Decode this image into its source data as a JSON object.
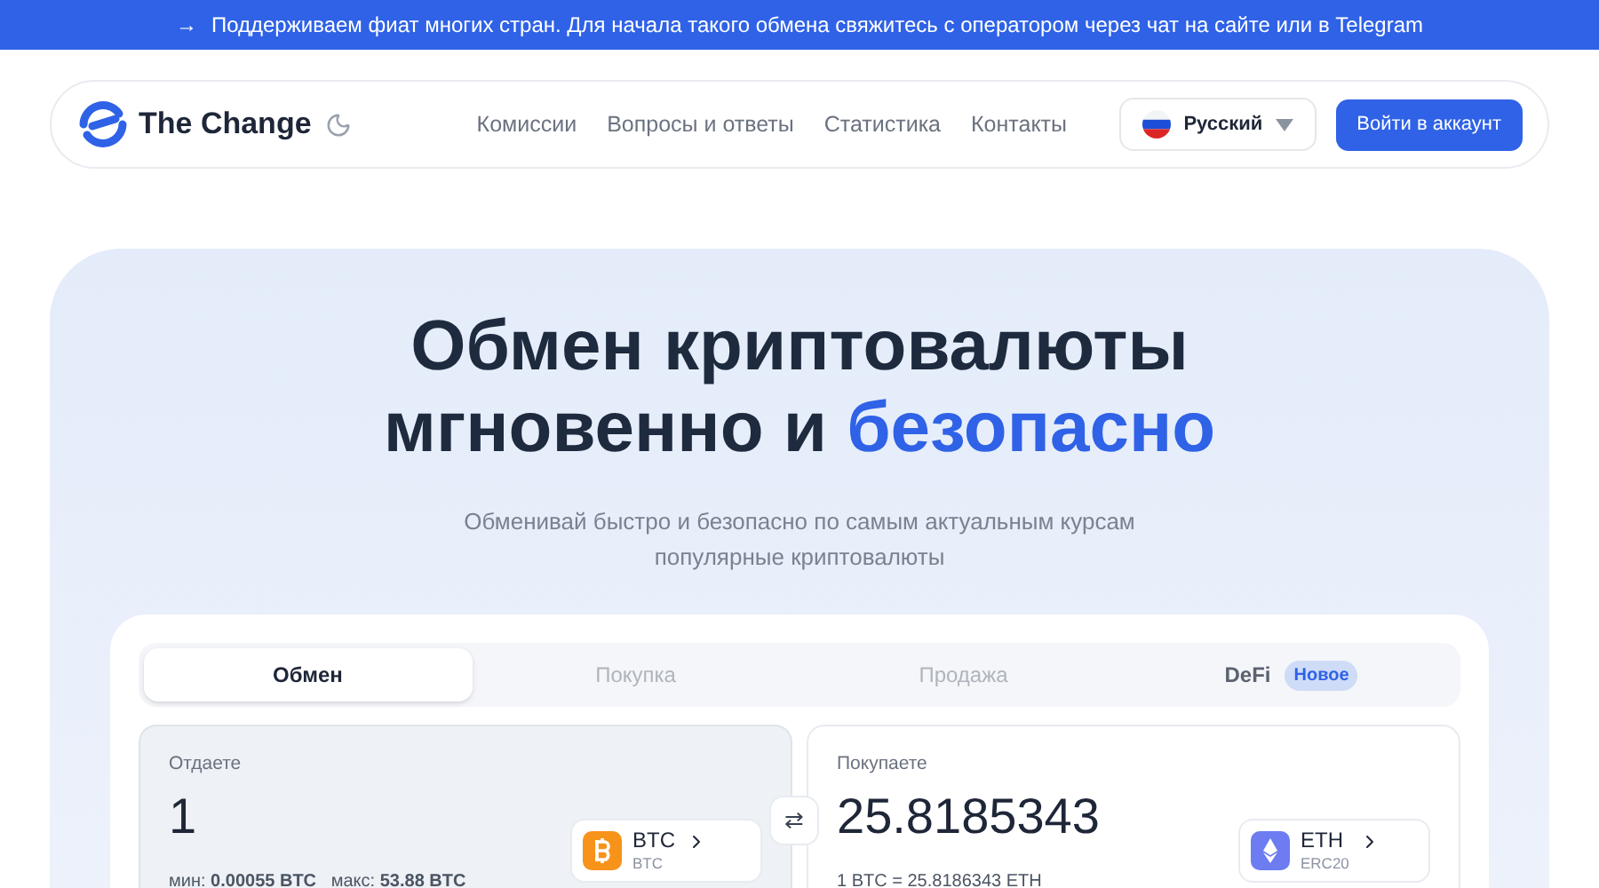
{
  "banner": {
    "arrow": "→",
    "text": "Поддерживаем фиат многих стран. Для начала такого обмена свяжитесь с оператором через чат на сайте или в Telegram"
  },
  "header": {
    "logo_text": "The Change",
    "nav": [
      "Комиссии",
      "Вопросы и ответы",
      "Статистика",
      "Контакты"
    ],
    "language": "Русский",
    "login": "Войти в аккаунт"
  },
  "hero": {
    "title_line1": "Обмен криптовалюты",
    "title_line2_start": "мгновенно и",
    "title_highlight": "безопасно",
    "subtitle": "Обменивай быстро и безопасно по самым актуальным курсам популярные криптовалюты"
  },
  "tabs": [
    {
      "label": "Обмен",
      "selected": true
    },
    {
      "label": "Покупка",
      "selected": false
    },
    {
      "label": "Продажа",
      "selected": false
    },
    {
      "label": "DeFi",
      "selected": false,
      "badge": "Новое"
    }
  ],
  "panels": [
    {
      "label": "Отдаете",
      "amount": "1",
      "coin": "BTC",
      "network": "BTC",
      "kind": "btc",
      "note": "мин: **0.00055 BTC**   макс: **53.88 BTC**",
      "selected": true
    },
    {
      "label": "Покупаете",
      "amount": "25.8185343",
      "coin": "ETH",
      "network": "ERC20",
      "kind": "eth",
      "note": "1 BTC = 25.8186343 ETH",
      "selected": false
    }
  ],
  "swap": "⇄"
}
